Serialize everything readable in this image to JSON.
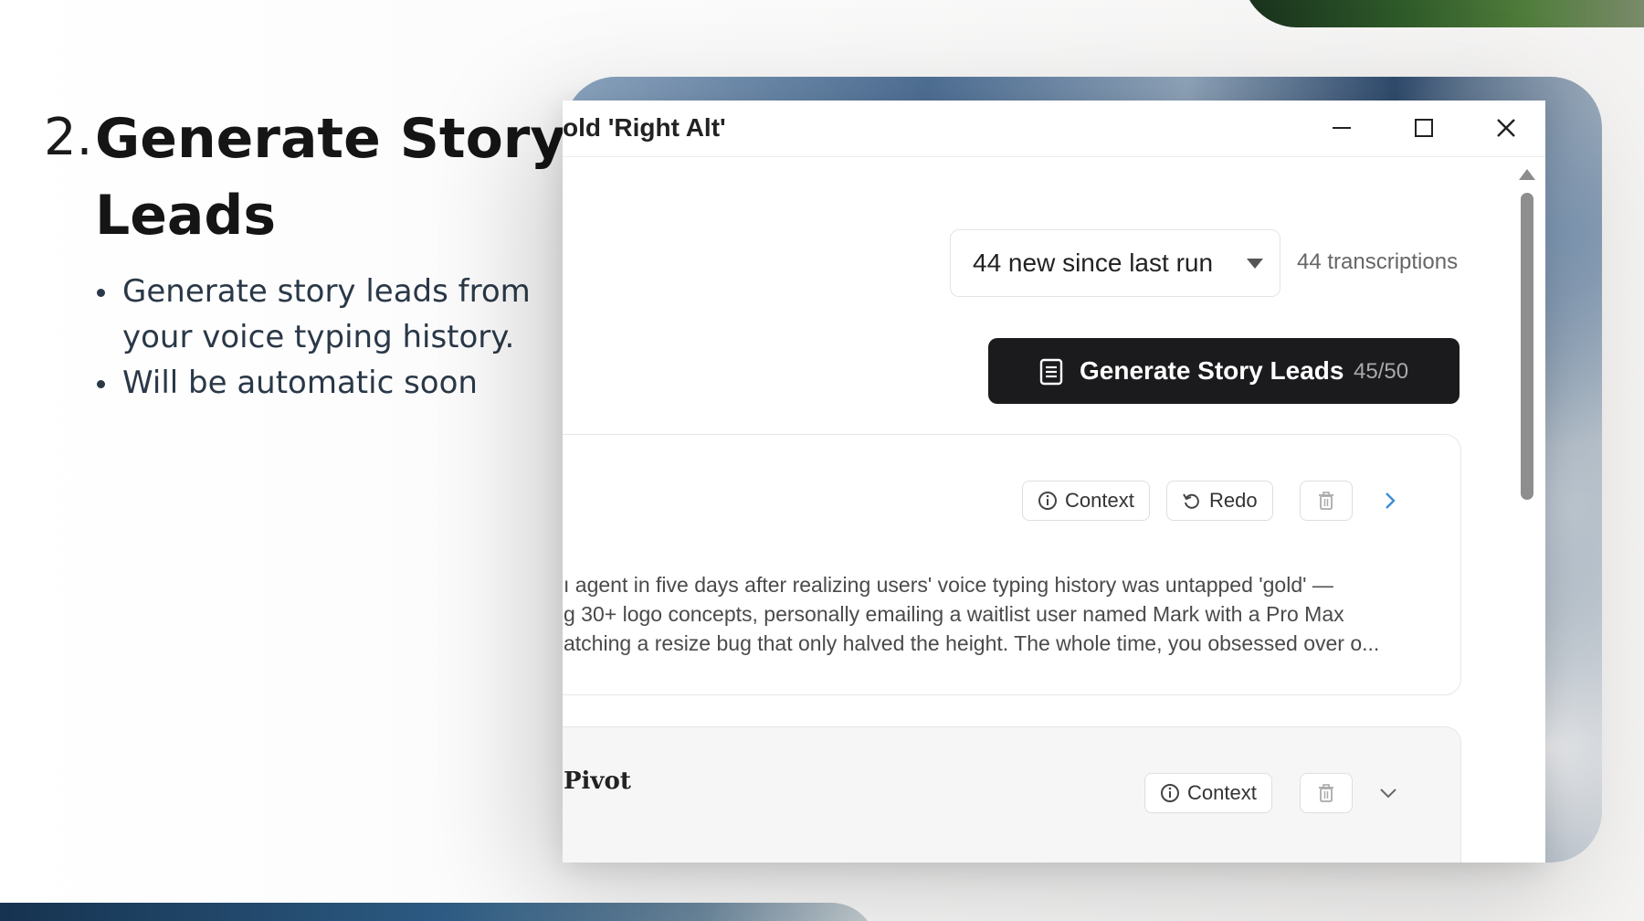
{
  "slide": {
    "number": "2.",
    "title": "Generate Story Leads",
    "bullets": [
      "Generate story leads from your voice typing history.",
      "Will be automatic soon"
    ]
  },
  "window": {
    "title": "old 'Right Alt'"
  },
  "toolbar": {
    "filter_selected": "44 new since last run",
    "transcriptions_count": "44 transcriptions",
    "generate_label": "Generate Story Leads",
    "generate_count": "45/50"
  },
  "leads": [
    {
      "context_label": "Context",
      "redo_label": "Redo",
      "summary": "ı agent in five days after realizing users' voice typing history was untapped 'gold' —\ng 30+ logo concepts, personally emailing a waitlist user named Mark with a Pro Max\natching a resize bug that only halved the height. The whole time, you obsessed over o..."
    },
    {
      "title": "Pivot",
      "context_label": "Context"
    }
  ],
  "icons": [
    "minimize-icon",
    "maximize-icon",
    "close-icon",
    "document-icon",
    "info-icon",
    "redo-icon",
    "trash-icon",
    "chevron-right-icon",
    "chevron-down-icon"
  ],
  "colors": {
    "button_dark": "#1b1b1d",
    "chevron_accent": "#3b8fd9"
  }
}
